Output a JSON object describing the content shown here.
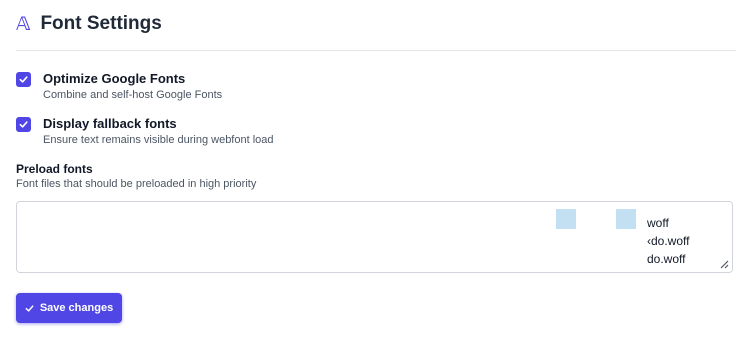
{
  "header": {
    "logo_glyph": "𝔸",
    "title": "Font Settings"
  },
  "options": [
    {
      "title": "Optimize Google Fonts",
      "description": "Combine and self-host Google Fonts",
      "checked": true
    },
    {
      "title": "Display fallback fonts",
      "description": "Ensure text remains visible during webfont load",
      "checked": true
    }
  ],
  "preload": {
    "title": "Preload fonts",
    "description": "Font files that should be preloaded in high priority",
    "visible_lines": [
      "woff",
      "‹do.woff",
      "do.woff"
    ]
  },
  "save_button": {
    "label": "Save changes",
    "icon": "check-icon"
  },
  "colors": {
    "accent": "#4f46e5",
    "border": "#d1d5db",
    "decor": "#c3e0f2"
  }
}
